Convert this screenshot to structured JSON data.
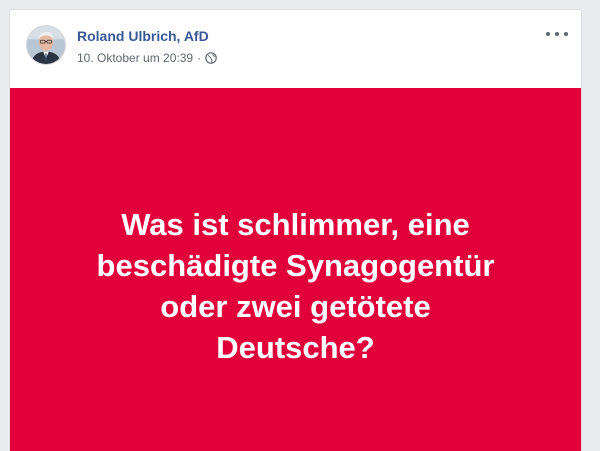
{
  "post": {
    "author": "Roland Ulbrich, AfD",
    "timestamp": "10. Oktober um 20:39",
    "separator": "·",
    "privacy_icon": "globe-icon",
    "menu_icon": "more-options-icon",
    "image": {
      "background": "#e2003a",
      "text": "Was ist schlimmer, eine\nbeschädigte Synagogentür\noder zwei getötete\nDeutsche?"
    }
  },
  "colors": {
    "author_link": "#385898",
    "meta_text": "#616770",
    "image_background": "#e2003a",
    "image_text": "#ffffff"
  }
}
